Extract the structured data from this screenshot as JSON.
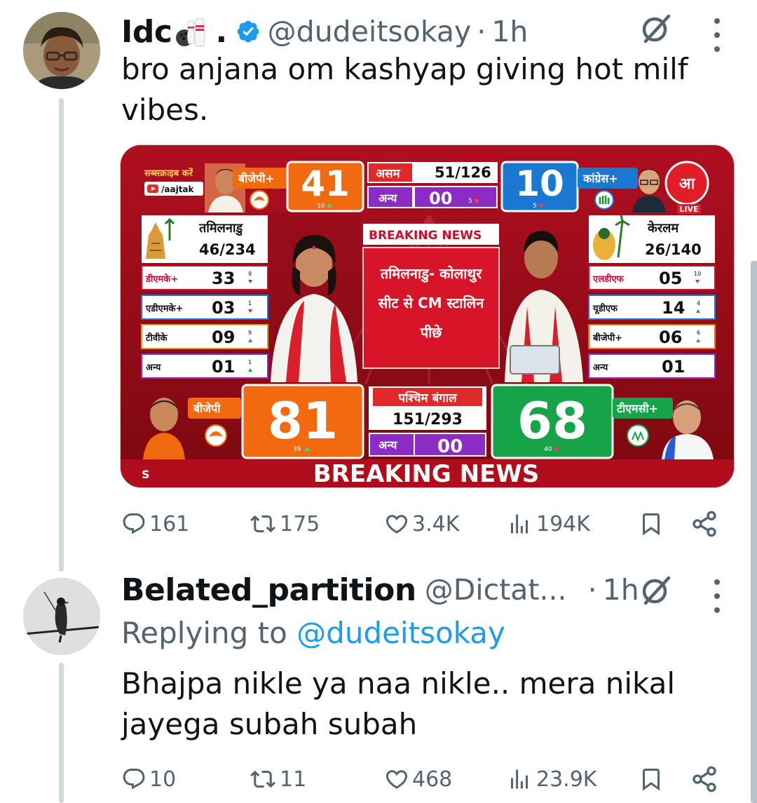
{
  "tweet1": {
    "display_name": "Idc",
    "name_suffix": ".",
    "handle": "@dudeitsokay",
    "separator": "·",
    "time": "1h",
    "text_line1": "bro anjana om kashyap giving hot milf",
    "text_line2": "vibes.",
    "media": {
      "subscribe_label": "सब्सक्राइब करें",
      "channel_handle": "/aajtak",
      "assam": {
        "bjp_label": "बीजेपी+",
        "bjp_seats": "41",
        "bjp_change": "10",
        "state_name": "असम",
        "state_count": "51/126",
        "others_label": "अन्य",
        "others_seats": "00",
        "others_change": "5",
        "cong_seats": "10",
        "cong_change": "5",
        "cong_label": "कांग्रेस+"
      },
      "live_label": "LIVE",
      "tamilnadu": {
        "state_name": "तमिलनाडु",
        "state_count": "46/234",
        "rows": [
          {
            "party": "डीएमके+",
            "seats": "33",
            "change": "9"
          },
          {
            "party": "एडीएमके+",
            "seats": "03",
            "change": "1"
          },
          {
            "party": "टीवीके",
            "seats": "09",
            "change": "9"
          },
          {
            "party": "अन्य",
            "seats": "01",
            "change": "1"
          }
        ]
      },
      "breaking_tag": "BREAKING NEWS",
      "headline_line1": "तमिलनाडु- कोलाथुर",
      "headline_line2": "सीट से CM स्टालिन",
      "headline_line3": "पीछे",
      "kerala": {
        "state_name": "केरलम",
        "state_count": "26/140",
        "rows": [
          {
            "party": "एलडीएफ",
            "seats": "05",
            "change": "10"
          },
          {
            "party": "यूडीएफ",
            "seats": "14",
            "change": "4"
          },
          {
            "party": "बीजेपी+",
            "seats": "06",
            "change": "6"
          },
          {
            "party": "अन्य",
            "seats": "01",
            "change": ""
          }
        ]
      },
      "bengal": {
        "bjp_label": "बीजेपी",
        "bjp_seats": "81",
        "bjp_change": "39",
        "state_name": "पश्चिम बंगाल",
        "state_count": "151/293",
        "others_label": "अन्य",
        "others_seats": "00",
        "tmc_seats": "68",
        "tmc_change": "40",
        "tmc_label": "टीएमसी+"
      },
      "ticker_left": "S",
      "ticker": "BREAKING NEWS"
    },
    "actions": {
      "replies": "161",
      "reposts": "175",
      "likes": "3.4K",
      "views": "194K"
    }
  },
  "tweet2": {
    "display_name": "Belated_partition",
    "handle": "@Dictat...",
    "separator": "·",
    "time": "1h",
    "replying_prefix": "Replying to",
    "replying_to": "@dudeitsokay",
    "text_line1": "Bhajpa nikle ya naa nikle.. mera nikal",
    "text_line2": "jayega subah subah",
    "actions": {
      "replies": "10",
      "reposts": "11",
      "likes": "468",
      "views": "23.9K"
    }
  },
  "colors": {
    "text": "#0f1419",
    "secondary": "#536471",
    "link": "#1d9bf0",
    "verified": "#1d9bf0",
    "thread_line": "#cfd9de",
    "bjp_orange": "#f26a10",
    "congress_blue": "#1a77d2",
    "tmc_green": "#16a34a",
    "broadcast_red": "#c8102e"
  }
}
